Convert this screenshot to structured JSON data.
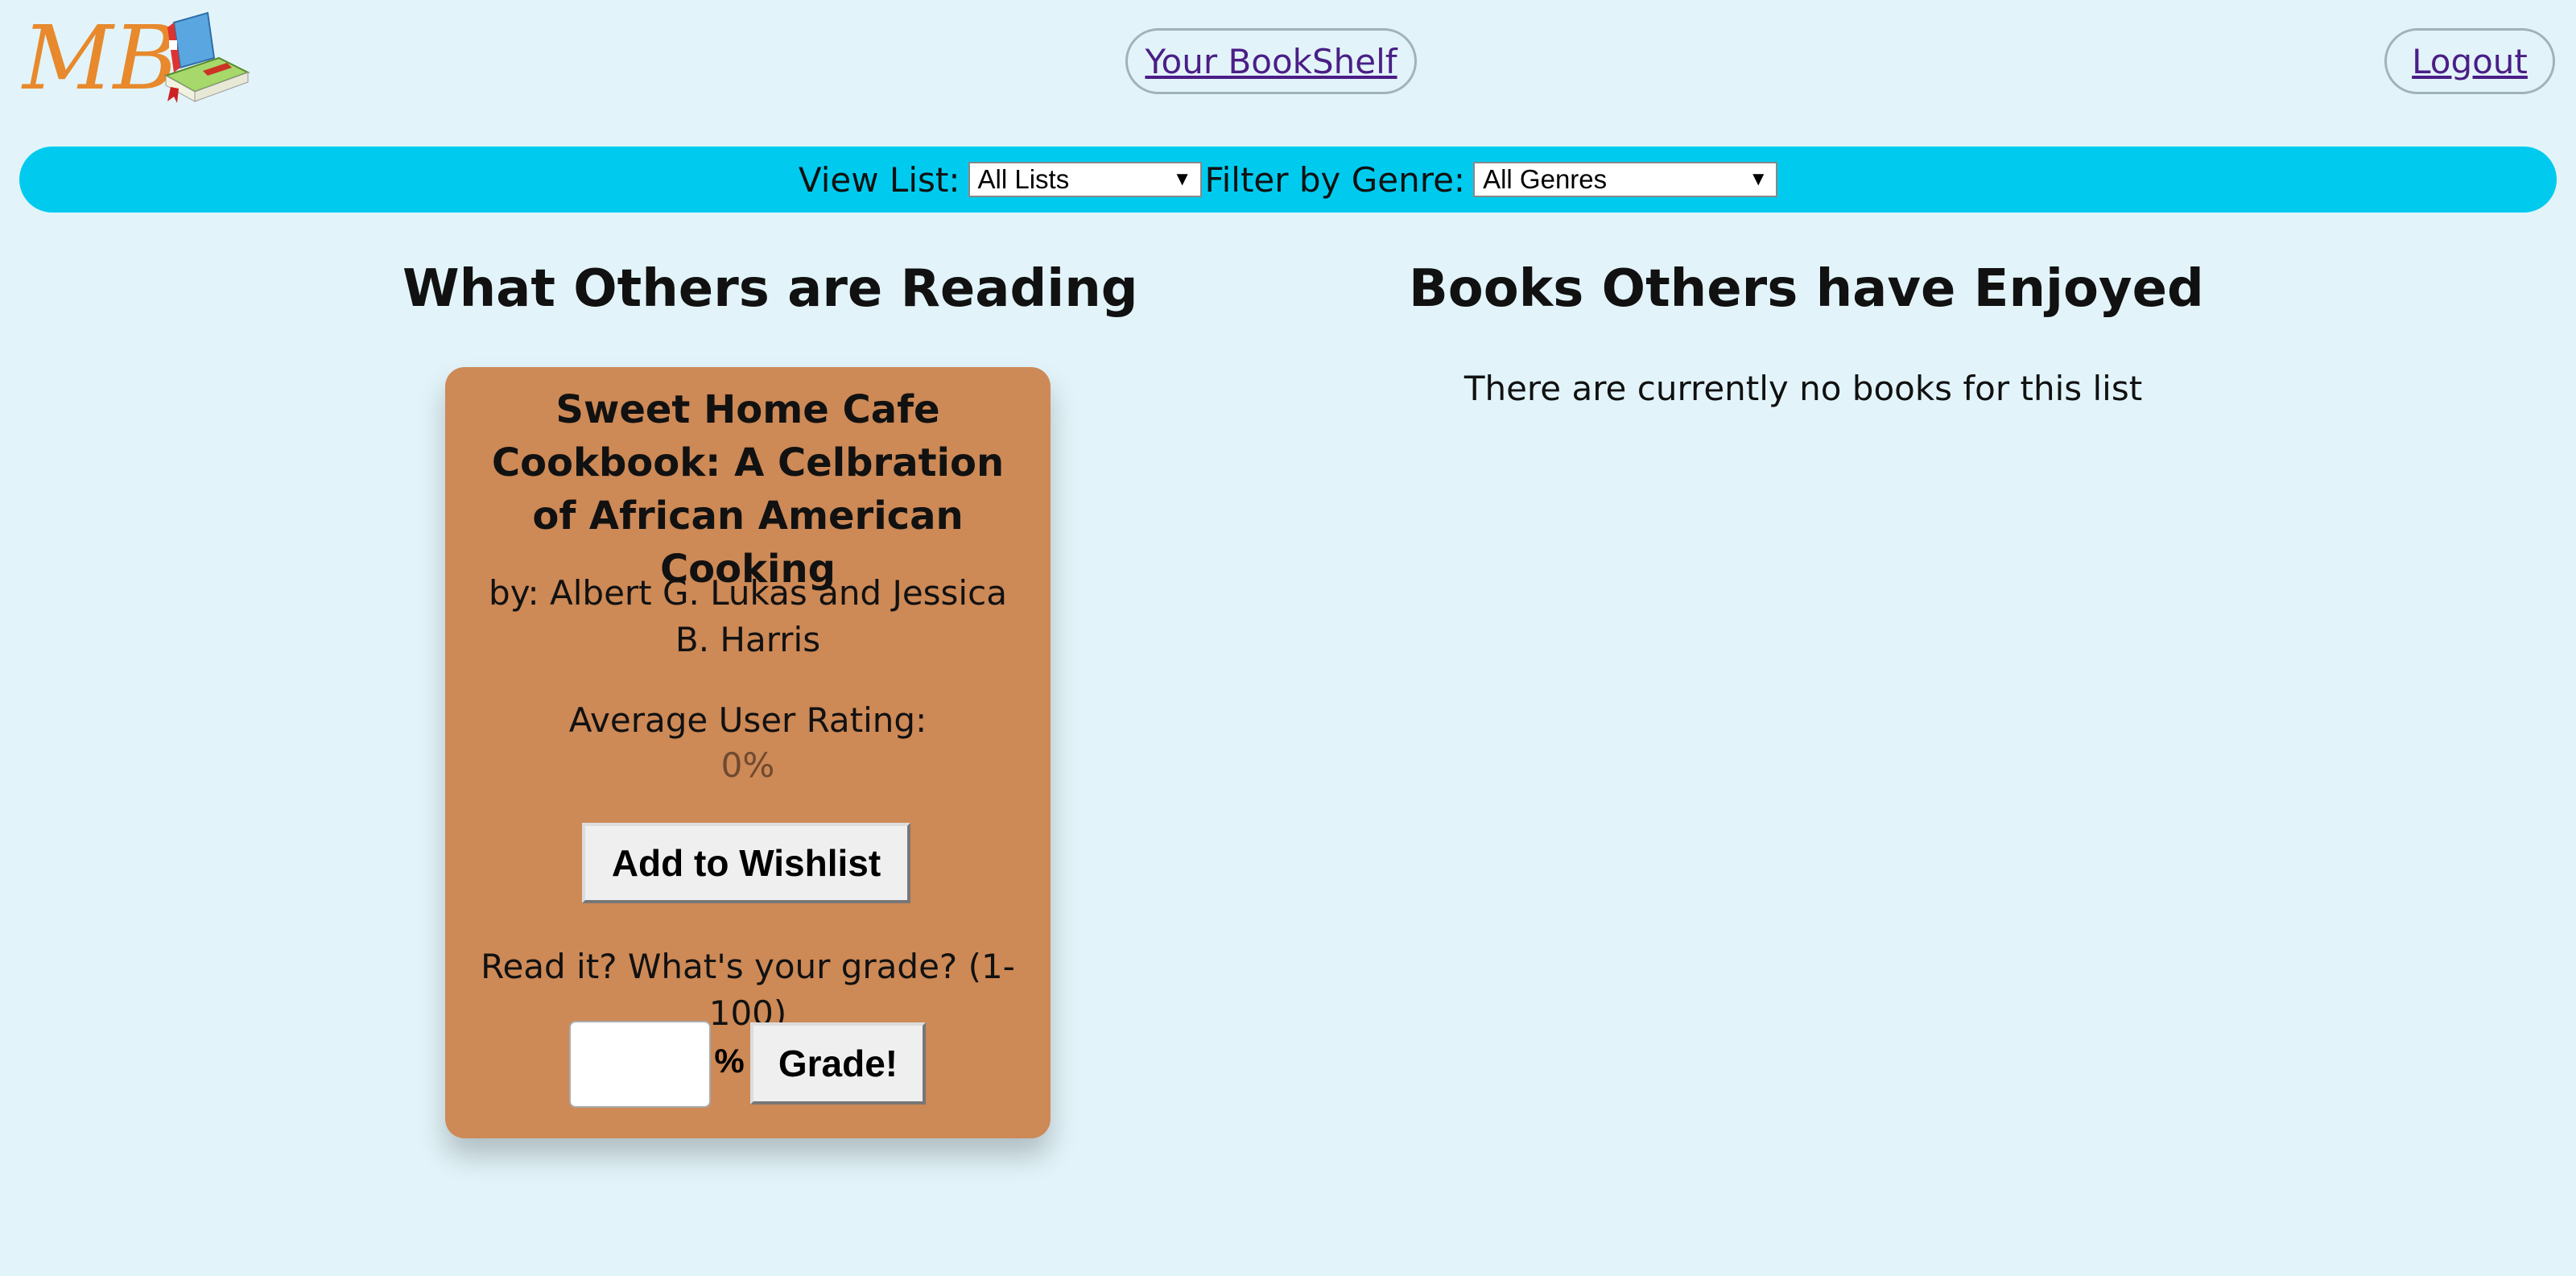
{
  "header": {
    "bookshelf_link": "Your BookShelf",
    "logout_link": "Logout",
    "logo_text": "MB"
  },
  "filters": {
    "view_list_label": "View List:",
    "view_list_value": "All Lists",
    "genre_label": "Filter by Genre:",
    "genre_value": "All Genres"
  },
  "sections": {
    "reading_heading": "What Others are Reading",
    "enjoyed_heading": "Books Others have Enjoyed",
    "enjoyed_empty_message": "There are currently no books for this list"
  },
  "book": {
    "title": "Sweet Home Cafe Cookbook: A Celbration of African American Cooking",
    "author": "by: Albert G. Lukas and Jessica B. Harris",
    "rating_label": "Average User Rating:",
    "rating_value": "0%",
    "wishlist_button": "Add to Wishlist",
    "grade_prompt": "Read it? What's your grade? (1-100)",
    "percent_symbol": "%",
    "grade_button": "Grade!"
  },
  "colors": {
    "page_background": "#e2f4f9",
    "filter_bar": "#00cbef",
    "card_background": "#cd8956",
    "link_color": "#4b1e86"
  },
  "icons": {
    "logo": "books-logo",
    "dropdown": "triangle-down-icon"
  }
}
